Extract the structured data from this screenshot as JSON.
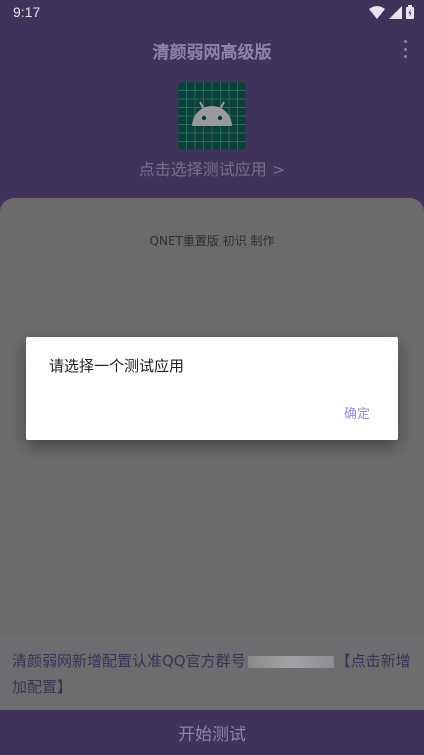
{
  "status_bar": {
    "time": "9:17"
  },
  "app_bar": {
    "title": "清颜弱网高级版"
  },
  "header": {
    "select_app_label": "点击选择测试应用 >"
  },
  "main": {
    "credit": "QNET重置版 初识 制作",
    "notice_part1": "清颜弱网新增配置认准QQ官方群号",
    "notice_part2": "【点击新增加配置】"
  },
  "bottom": {
    "start_label": "开始测试"
  },
  "dialog": {
    "message": "请选择一个测试应用",
    "ok_label": "确定"
  },
  "colors": {
    "brand": "#3f3359",
    "dialog_accent": "#9b8bd0"
  }
}
